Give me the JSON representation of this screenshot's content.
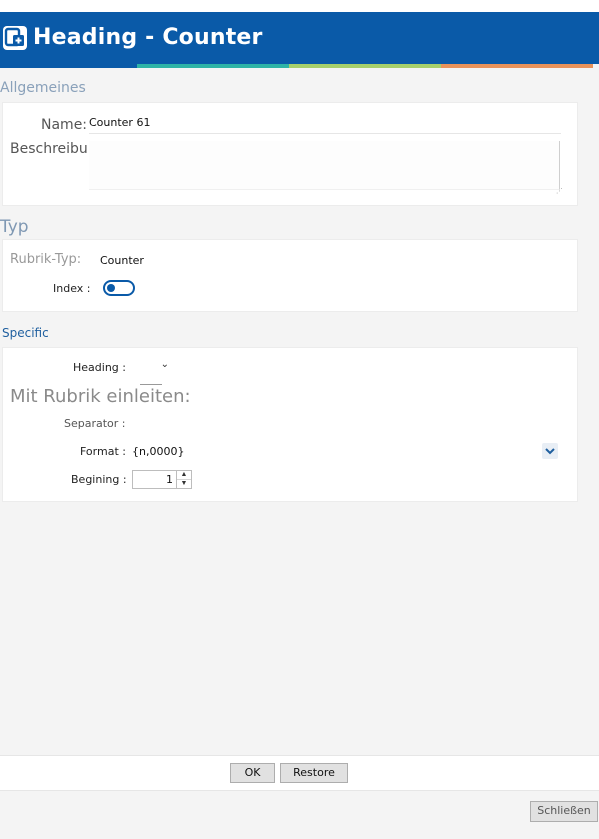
{
  "header": {
    "title": "Heading - Counter",
    "color": "#0a5aa8",
    "stripe_colors": [
      "#2eb3a6",
      "#a6cf6b",
      "#e8925a"
    ]
  },
  "allgemeines": {
    "section_label": "Allgemeines",
    "name_label": "Name:",
    "name_value": "Counter 61",
    "beschreibung_label": "Beschreibung:"
  },
  "typ": {
    "section_label": "Typ",
    "rubrik_typ_label": "Rubrik-Typ:",
    "rubrik_typ_value": "Counter",
    "index_label": "Index :",
    "index_toggle_on": false
  },
  "specific": {
    "section_label": "Specific",
    "heading_label": "Heading :",
    "heading_value": "",
    "mit_rubrik_label": "Mit Rubrik einleiten:",
    "separator_label": "Separator :",
    "format_label": "Format :",
    "format_value": "{n,0000}",
    "begining_label": "Begining :",
    "begining_value": "1"
  },
  "buttons": {
    "ok": "OK",
    "restore": "Restore",
    "close": "Schließen"
  }
}
